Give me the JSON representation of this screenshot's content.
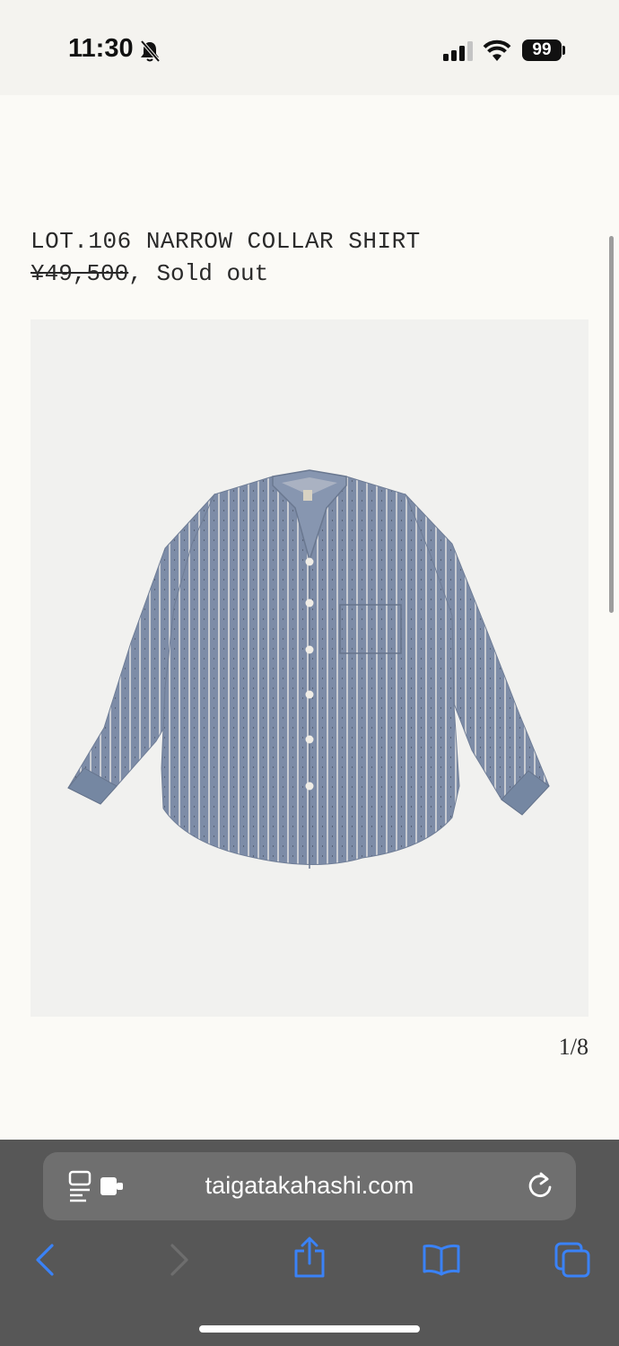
{
  "status": {
    "time": "11:30",
    "battery": "99"
  },
  "product": {
    "title": "LOT.106 NARROW COLLAR SHIRT",
    "price_old": "¥49,500",
    "price_separator": ", ",
    "availability": "Sold out",
    "image_counter": "1/8"
  },
  "browser": {
    "url": "taigatakahashi.com"
  },
  "icons": {
    "status": [
      "bell-slash-icon",
      "cellular-signal-icon",
      "wifi-icon",
      "battery-icon"
    ],
    "toolbar": [
      "back-icon",
      "forward-icon",
      "share-icon",
      "bookmarks-icon",
      "tabs-icon"
    ],
    "url_bar": [
      "reader-mode-icon",
      "reload-icon"
    ]
  },
  "colors": {
    "page_background": "#fbfaf6",
    "toolbar_background": "#575757",
    "accent_blue": "#3a82f7",
    "shirt_blue": "#7d8ca7"
  }
}
